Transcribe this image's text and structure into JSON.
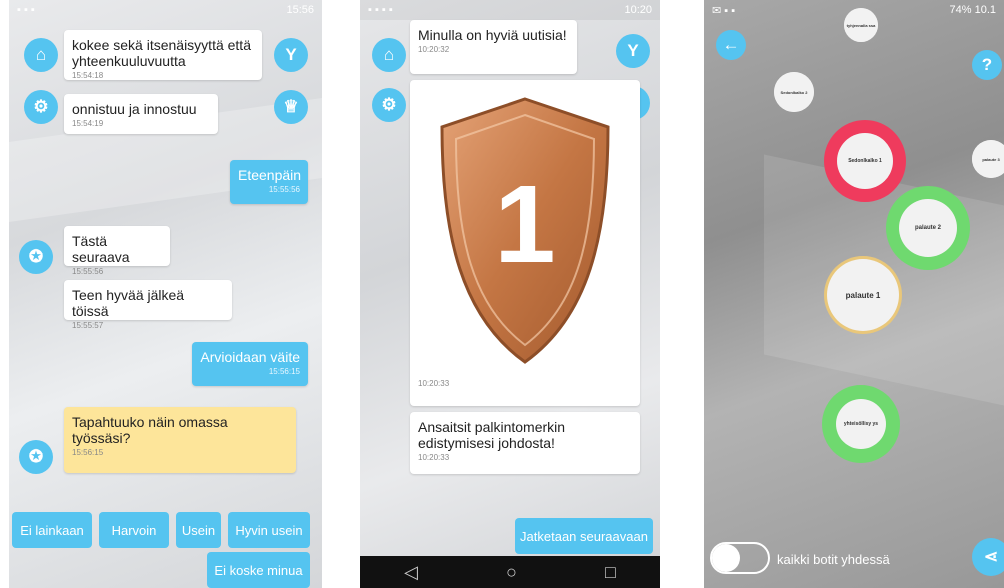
{
  "screen1": {
    "messages": [
      {
        "text": "kokee sekä itsenäisyyttä että yhteenkuuluvuutta",
        "time": "15:54:18"
      },
      {
        "text": "onnistuu ja innostuu",
        "time": "15:54:19"
      },
      {
        "text": "Eteenpäin",
        "time": "15:55:56"
      },
      {
        "text": "Tästä seuraava",
        "time": "15:55:56"
      },
      {
        "text": "Teen hyvää jälkeä töissä",
        "time": "15:55:57"
      },
      {
        "text": "Arvioidaan väite",
        "time": "15:56:15"
      },
      {
        "text": "Tapahtuuko näin omassa työssäsi?",
        "time": "15:56:15"
      }
    ],
    "answers": [
      "Ei lainkaan",
      "Harvoin",
      "Usein",
      "Hyvin usein",
      "Ei koske minua"
    ],
    "status_time": "15:56"
  },
  "screen2": {
    "messages": [
      {
        "text": "Minulla on hyviä uutisia!",
        "time": "10:20:32"
      },
      {
        "badge_number": "1",
        "time": "10:20:33"
      },
      {
        "text": "Ansaitsit palkintomerkin edistymisesi johdosta!",
        "time": "10:20:33"
      }
    ],
    "continue_label": "Jatketaan seuraavaan",
    "status_time": "10:20"
  },
  "screen3": {
    "status_battery": "74%",
    "status_time": "10.1",
    "nodes": [
      "tyhjennalla ssa",
      "Sedonlkalko 2",
      "Sedonlkalko 1",
      "palaute 2",
      "palaute 1",
      "palaute 3",
      "yhteisöllisy ys"
    ],
    "toggle_label": "kaikki botit yhdessä",
    "help_label": "?"
  },
  "colors": {
    "accent": "#55c4f0",
    "red": "#ef3b5d",
    "green": "#6fd96f",
    "gold": "#e9c77a",
    "bronze": "#c77a45"
  }
}
